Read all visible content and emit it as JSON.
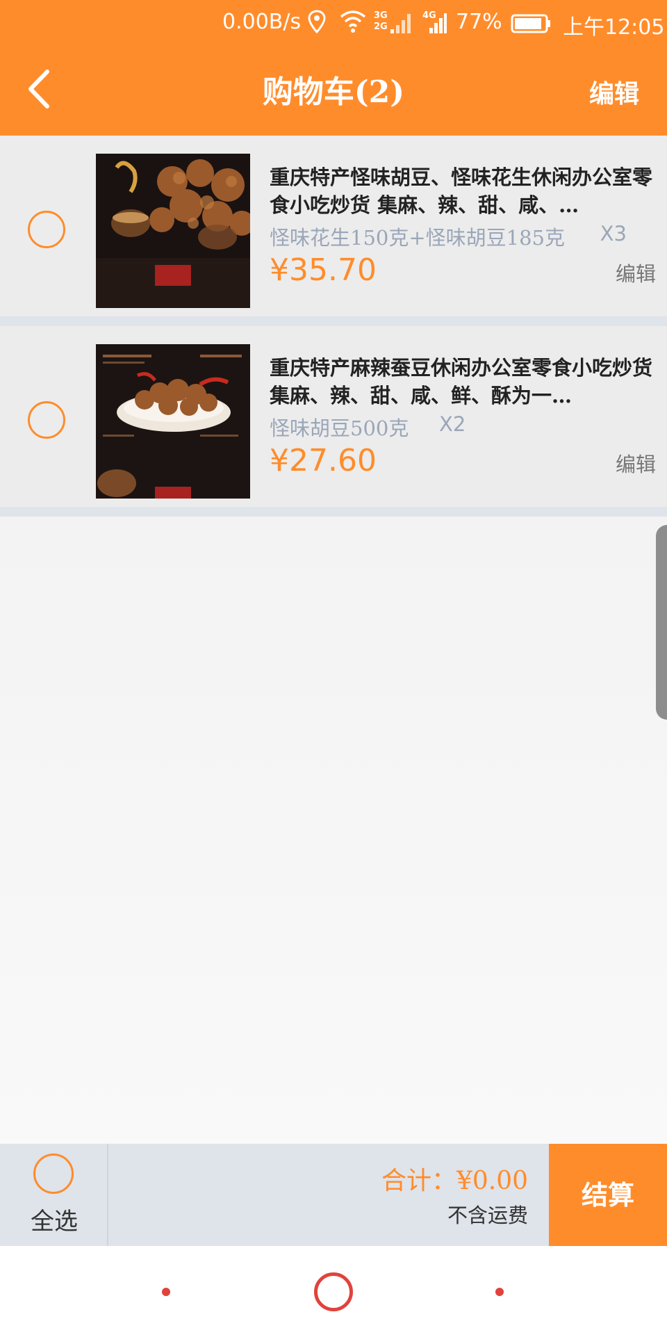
{
  "status_bar": {
    "net_speed": "0.00B/s",
    "sim1_network": "3G",
    "sim1_network2": "2G",
    "sim2_network": "4G",
    "battery_percent": "77%",
    "time": "上午12:05",
    "icons": [
      "location-icon",
      "wifi-icon",
      "signal-icon",
      "battery-icon"
    ]
  },
  "header": {
    "title": "购物车(2)",
    "edit_label": "编辑",
    "back_icon": "chevron-left-icon"
  },
  "cart": {
    "items": [
      {
        "title": "重庆特产怪味胡豆、怪味花生休闲办公室零食小吃炒货 集麻、辣、甜、咸、…",
        "spec": "怪味花生150克+怪味胡豆185克",
        "qty": "X3",
        "price": "¥35.70",
        "edit_label": "编辑",
        "selected": false
      },
      {
        "title": "重庆特产麻辣蚕豆休闲办公室零食小吃炒货 集麻、辣、甜、咸、鲜、酥为一…",
        "spec": "怪味胡豆500克",
        "qty": "X2",
        "price": "¥27.60",
        "edit_label": "编辑",
        "selected": false
      }
    ]
  },
  "checkout": {
    "select_all_label": "全选",
    "total_label": "合计：¥0.00",
    "shipping_note": "不含运费",
    "checkout_label": "结算"
  },
  "colors": {
    "accent": "#FF8C2B",
    "bar_bg": "#dfe3ea",
    "spec_text": "#9aa6b8",
    "nav_red": "#e0433c"
  }
}
